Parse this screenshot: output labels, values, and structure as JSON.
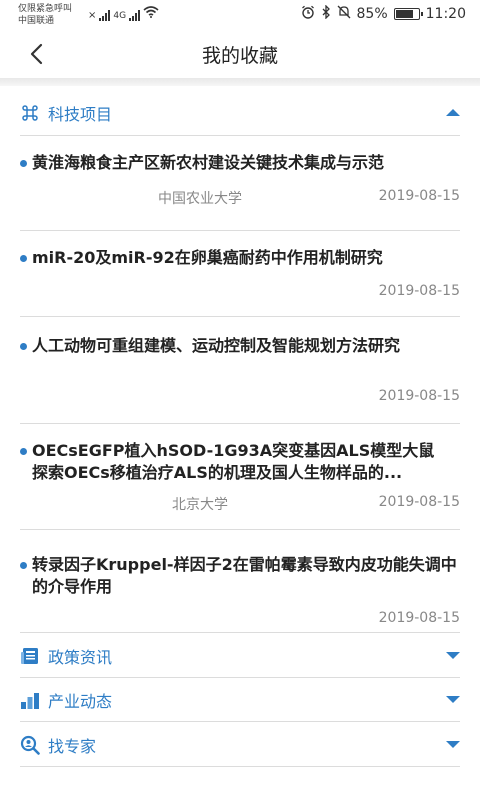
{
  "status_bar": {
    "carrier_line1": "仅限紧急呼叫",
    "carrier_line2": "中国联通",
    "network": "4G",
    "battery": "85%",
    "battery_level": 0.85,
    "time": "11:20"
  },
  "header": {
    "title": "我的收藏",
    "back_icon": "chevron-left-icon"
  },
  "sections": {
    "tech": {
      "label": "科技项目",
      "icon": "command-icon",
      "expanded": true
    },
    "policy": {
      "label": "政策资讯",
      "icon": "news-icon",
      "expanded": false
    },
    "industry": {
      "label": "产业动态",
      "icon": "bar-chart-icon",
      "expanded": false
    },
    "expert": {
      "label": "找专家",
      "icon": "search-person-icon",
      "expanded": false
    }
  },
  "items": [
    {
      "title": "黄淮海粮食主产区新农村建设关键技术集成与示范",
      "source": "中国农业大学",
      "date": "2019-08-15"
    },
    {
      "title": "miR-20及miR-92在卵巢癌耐药中作用机制研究",
      "source": "",
      "date": "2019-08-15"
    },
    {
      "title": "人工动物可重组建模、运动控制及智能规划方法研究",
      "source": "",
      "date": "2019-08-15"
    },
    {
      "title_line1": "OECsEGFP植入hSOD-1G93A突变基因ALS模型大鼠",
      "title_line2": "探索OECs移植治疗ALS的机理及国人生物样品的...",
      "source": "北京大学",
      "date": "2019-08-15"
    },
    {
      "title": "转录因子Kruppel-样因子2在雷帕霉素导致内皮功能失调中的介导作用",
      "source": "",
      "date": "2019-08-15"
    }
  ],
  "colors": {
    "accent": "#2e7dc5",
    "text": "#222222",
    "muted": "#888888",
    "divider": "#dcdcdc"
  }
}
